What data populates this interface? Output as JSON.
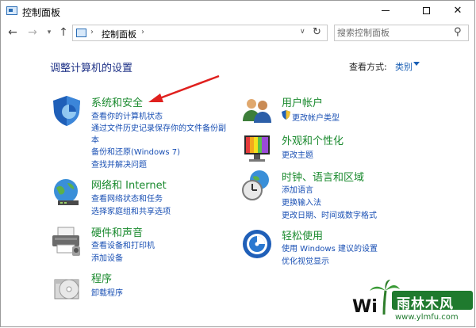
{
  "window": {
    "title": "控制面板"
  },
  "nav": {
    "crumb": "控制面板",
    "crumb_sep": "›",
    "search_placeholder": "搜索控制面板"
  },
  "main": {
    "heading": "调整计算机的设置",
    "view_by_label": "查看方式:",
    "view_by_value": "类别"
  },
  "categories_left": [
    {
      "title": "系统和安全",
      "icon": "shield-icon",
      "links": [
        "查看你的计算机状态",
        "通过文件历史记录保存你的文件备份副",
        "本",
        "备份和还原(Windows 7)",
        "查找并解决问题"
      ]
    },
    {
      "title": "网络和 Internet",
      "icon": "network-globe-icon",
      "links": [
        "查看网络状态和任务",
        "选择家庭组和共享选项"
      ]
    },
    {
      "title": "硬件和声音",
      "icon": "printer-icon",
      "links": [
        "查看设备和打印机",
        "添加设备"
      ]
    },
    {
      "title": "程序",
      "icon": "programs-disc-icon",
      "links": [
        "卸载程序"
      ]
    }
  ],
  "categories_right": [
    {
      "title": "用户帐户",
      "icon": "users-icon",
      "links": [
        "更改帐户类型"
      ]
    },
    {
      "title": "外观和个性化",
      "icon": "display-icon",
      "links": [
        "更改主题"
      ]
    },
    {
      "title": "时钟、语言和区域",
      "icon": "clock-globe-icon",
      "links": [
        "添加语言",
        "更换输入法",
        "更改日期、时间或数字格式"
      ]
    },
    {
      "title": "轻松使用",
      "icon": "ease-of-access-icon",
      "links": [
        "使用 Windows 建议的设置",
        "优化视觉显示"
      ]
    }
  ],
  "watermark": {
    "main": "雨林木风",
    "sub": "www.ylmfu.com",
    "partial": "Wi"
  },
  "colors": {
    "heading": "#1e3287",
    "category": "#1a8a2e",
    "link": "#1a50b4",
    "arrow": "#e0201e"
  }
}
